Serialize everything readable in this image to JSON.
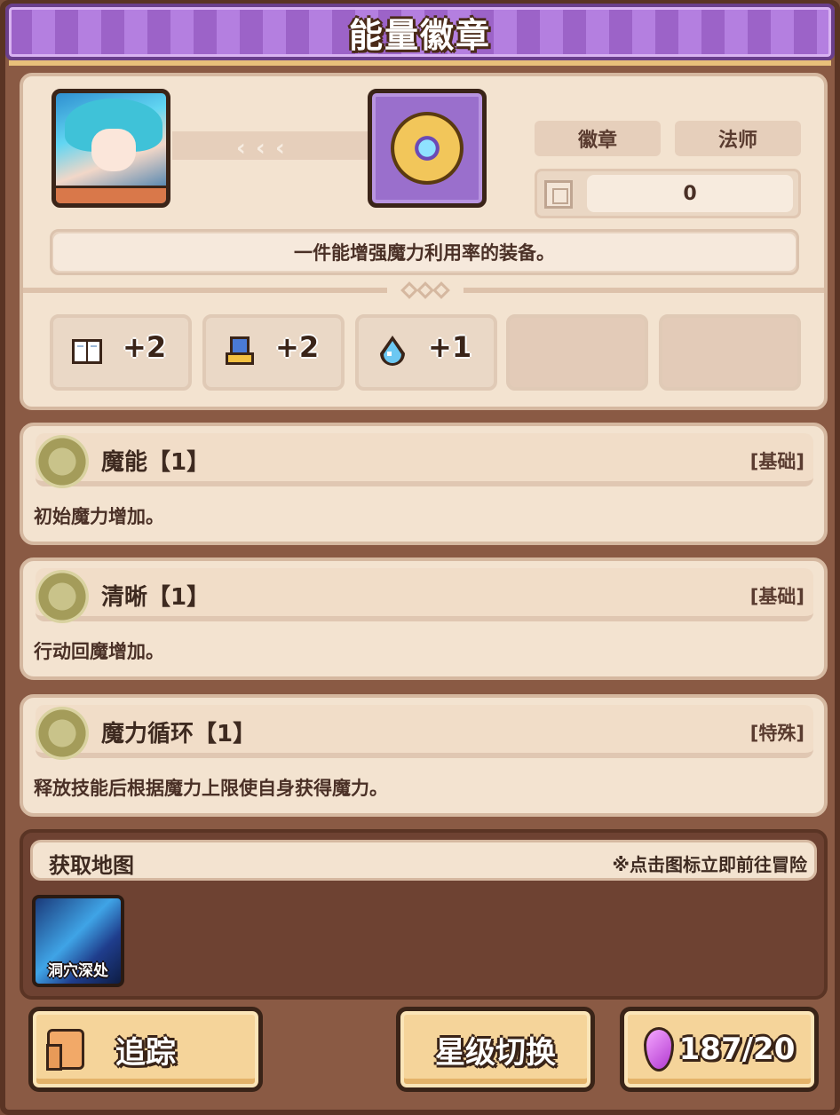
{
  "window": {
    "title": "能量徽章"
  },
  "item": {
    "type_tag": "徽章",
    "class_tag": "法师",
    "count_value": "0",
    "description": "一件能增强魔力利用率的装备。"
  },
  "stats": [
    {
      "icon": "book-icon",
      "value": "+2"
    },
    {
      "icon": "boot-icon",
      "value": "+2"
    },
    {
      "icon": "mana-drop-icon",
      "value": "+1"
    }
  ],
  "skills": [
    {
      "name": "魔能【1】",
      "type": "[基础]",
      "desc": "初始魔力增加。"
    },
    {
      "name": "清晰【1】",
      "type": "[基础]",
      "desc": "行动回魔增加。"
    },
    {
      "name": "魔力循环【1】",
      "type": "[特殊]",
      "desc": "释放技能后根据魔力上限使自身获得魔力。"
    }
  ],
  "map": {
    "title": "获取地图",
    "hint": "※点击图标立即前往冒险",
    "locations": [
      {
        "label": "洞穴深处"
      }
    ]
  },
  "buttons": {
    "track": "追踪",
    "star_switch": "星级切换",
    "gem_cost": "187/20"
  },
  "colors": {
    "title_purple": "#9c63c8",
    "panel_bg": "#f3e3d0",
    "frame_brown": "#8a5a44",
    "button_gold": "#f5d49a",
    "gem_pink": "#b23ad0"
  }
}
